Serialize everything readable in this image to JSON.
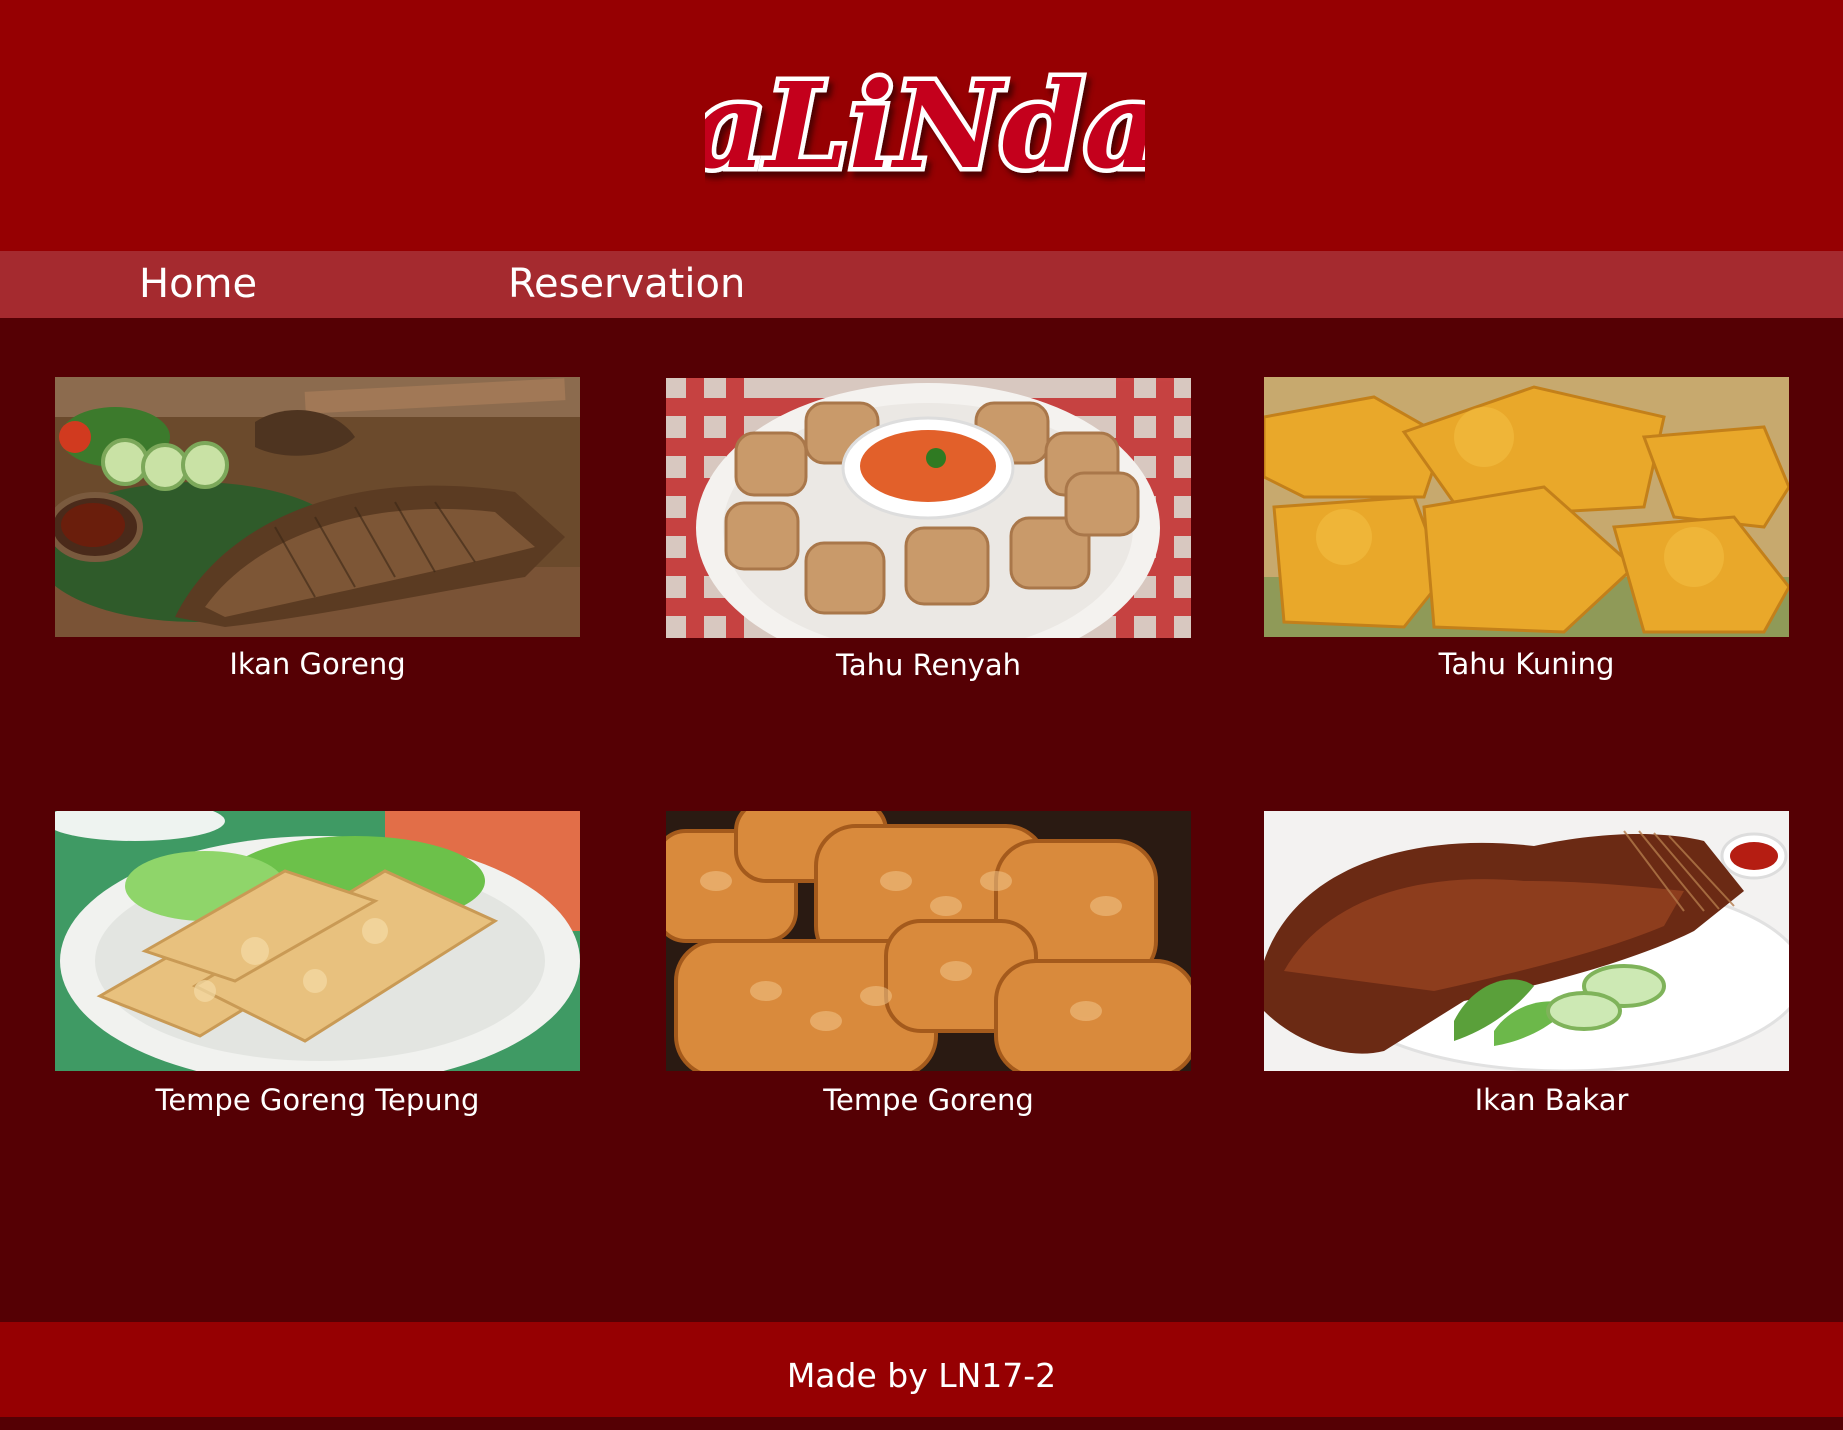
{
  "header": {
    "logo_text": "aLiNda",
    "logo_colors": {
      "fill": "#c4001a",
      "outline": "#ffffff",
      "shadow": "#3a0004"
    }
  },
  "nav": {
    "home_label": "Home",
    "reservation_label": "Reservation"
  },
  "menu": {
    "items": [
      {
        "label": "Ikan Goreng",
        "image": "fried-fish-photo"
      },
      {
        "label": "Tahu Renyah",
        "image": "crispy-tofu-photo"
      },
      {
        "label": "Tahu Kuning",
        "image": "yellow-tofu-photo"
      },
      {
        "label": "Tempe Goreng Tepung",
        "image": "battered-tempeh-photo"
      },
      {
        "label": "Tempe Goreng",
        "image": "fried-tempeh-photo"
      },
      {
        "label": "Ikan Bakar",
        "image": "grilled-fish-photo"
      }
    ]
  },
  "footer": {
    "text": "Made by LN17-2"
  },
  "colors": {
    "header_bg": "#960002",
    "nav_bg": "#a52a2f",
    "page_bg": "#550004",
    "text": "#ffffff"
  }
}
